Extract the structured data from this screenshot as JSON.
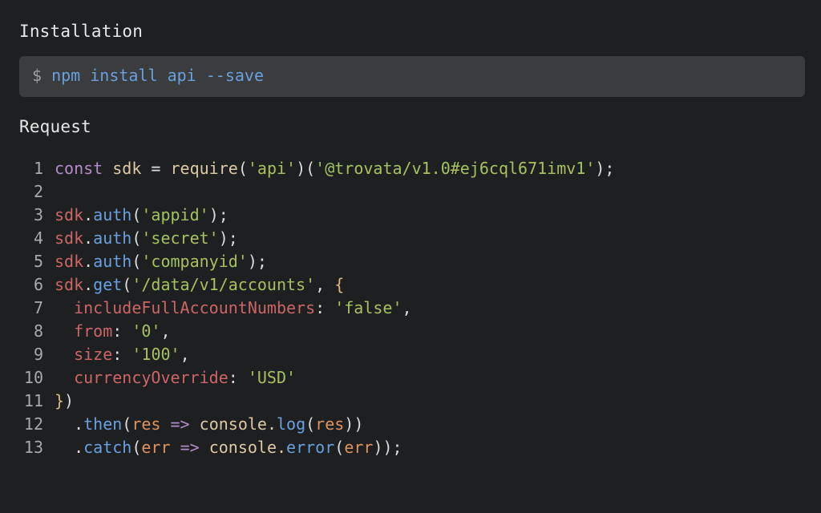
{
  "sections": {
    "installation": {
      "title": "Installation",
      "prompt": "$",
      "command": "npm install api --save"
    },
    "request": {
      "title": "Request"
    }
  },
  "code": {
    "lines": [
      [
        {
          "t": "const ",
          "c": "tk-kw"
        },
        {
          "t": "sdk",
          "c": "tk-req"
        },
        {
          "t": " ",
          "c": "tk-op"
        },
        {
          "t": "=",
          "c": "tk-op"
        },
        {
          "t": " ",
          "c": "tk-op"
        },
        {
          "t": "require",
          "c": "tk-req"
        },
        {
          "t": "(",
          "c": "tk-ident"
        },
        {
          "t": "'api'",
          "c": "tk-str"
        },
        {
          "t": ")(",
          "c": "tk-ident"
        },
        {
          "t": "'@trovata/v1.0#ej6cql671imv1'",
          "c": "tk-str"
        },
        {
          "t": ");",
          "c": "tk-ident"
        }
      ],
      [
        {
          "t": "",
          "c": "tk-ident"
        }
      ],
      [
        {
          "t": "sdk",
          "c": "tk-prop"
        },
        {
          "t": ".",
          "c": "tk-punct"
        },
        {
          "t": "auth",
          "c": "tk-fn"
        },
        {
          "t": "(",
          "c": "tk-ident"
        },
        {
          "t": "'appid'",
          "c": "tk-str"
        },
        {
          "t": ");",
          "c": "tk-ident"
        }
      ],
      [
        {
          "t": "sdk",
          "c": "tk-prop"
        },
        {
          "t": ".",
          "c": "tk-punct"
        },
        {
          "t": "auth",
          "c": "tk-fn"
        },
        {
          "t": "(",
          "c": "tk-ident"
        },
        {
          "t": "'secret'",
          "c": "tk-str"
        },
        {
          "t": ");",
          "c": "tk-ident"
        }
      ],
      [
        {
          "t": "sdk",
          "c": "tk-prop"
        },
        {
          "t": ".",
          "c": "tk-punct"
        },
        {
          "t": "auth",
          "c": "tk-fn"
        },
        {
          "t": "(",
          "c": "tk-ident"
        },
        {
          "t": "'companyid'",
          "c": "tk-str"
        },
        {
          "t": ");",
          "c": "tk-ident"
        }
      ],
      [
        {
          "t": "sdk",
          "c": "tk-prop"
        },
        {
          "t": ".",
          "c": "tk-punct"
        },
        {
          "t": "get",
          "c": "tk-fn"
        },
        {
          "t": "(",
          "c": "tk-ident"
        },
        {
          "t": "'/data/v1/accounts'",
          "c": "tk-str"
        },
        {
          "t": ", ",
          "c": "tk-ident"
        },
        {
          "t": "{",
          "c": "tk-brace"
        }
      ],
      [
        {
          "t": "  ",
          "c": "tk-ident"
        },
        {
          "t": "includeFullAccountNumbers",
          "c": "tk-prop"
        },
        {
          "t": ":",
          "c": "tk-ident"
        },
        {
          "t": " ",
          "c": "tk-ident"
        },
        {
          "t": "'false'",
          "c": "tk-str"
        },
        {
          "t": ",",
          "c": "tk-ident"
        }
      ],
      [
        {
          "t": "  ",
          "c": "tk-ident"
        },
        {
          "t": "from",
          "c": "tk-prop"
        },
        {
          "t": ":",
          "c": "tk-ident"
        },
        {
          "t": " ",
          "c": "tk-ident"
        },
        {
          "t": "'0'",
          "c": "tk-str"
        },
        {
          "t": ",",
          "c": "tk-ident"
        }
      ],
      [
        {
          "t": "  ",
          "c": "tk-ident"
        },
        {
          "t": "size",
          "c": "tk-prop"
        },
        {
          "t": ":",
          "c": "tk-ident"
        },
        {
          "t": " ",
          "c": "tk-ident"
        },
        {
          "t": "'100'",
          "c": "tk-str"
        },
        {
          "t": ",",
          "c": "tk-ident"
        }
      ],
      [
        {
          "t": "  ",
          "c": "tk-ident"
        },
        {
          "t": "currencyOverride",
          "c": "tk-prop"
        },
        {
          "t": ":",
          "c": "tk-ident"
        },
        {
          "t": " ",
          "c": "tk-ident"
        },
        {
          "t": "'USD'",
          "c": "tk-str"
        }
      ],
      [
        {
          "t": "}",
          "c": "tk-brace"
        },
        {
          "t": ")",
          "c": "tk-ident"
        }
      ],
      [
        {
          "t": "  .",
          "c": "tk-ident"
        },
        {
          "t": "then",
          "c": "tk-fn"
        },
        {
          "t": "(",
          "c": "tk-ident"
        },
        {
          "t": "res",
          "c": "tk-arg"
        },
        {
          "t": " ",
          "c": "tk-ident"
        },
        {
          "t": "=>",
          "c": "tk-kw"
        },
        {
          "t": " ",
          "c": "tk-ident"
        },
        {
          "t": "console",
          "c": "tk-req"
        },
        {
          "t": ".",
          "c": "tk-req"
        },
        {
          "t": "log",
          "c": "tk-fn"
        },
        {
          "t": "(",
          "c": "tk-ident"
        },
        {
          "t": "res",
          "c": "tk-arg"
        },
        {
          "t": "))",
          "c": "tk-ident"
        }
      ],
      [
        {
          "t": "  .",
          "c": "tk-ident"
        },
        {
          "t": "catch",
          "c": "tk-fn"
        },
        {
          "t": "(",
          "c": "tk-ident"
        },
        {
          "t": "err",
          "c": "tk-arg"
        },
        {
          "t": " ",
          "c": "tk-ident"
        },
        {
          "t": "=>",
          "c": "tk-kw"
        },
        {
          "t": " ",
          "c": "tk-ident"
        },
        {
          "t": "console",
          "c": "tk-req"
        },
        {
          "t": ".",
          "c": "tk-req"
        },
        {
          "t": "error",
          "c": "tk-fn"
        },
        {
          "t": "(",
          "c": "tk-ident"
        },
        {
          "t": "err",
          "c": "tk-arg"
        },
        {
          "t": "));",
          "c": "tk-ident"
        }
      ]
    ]
  }
}
